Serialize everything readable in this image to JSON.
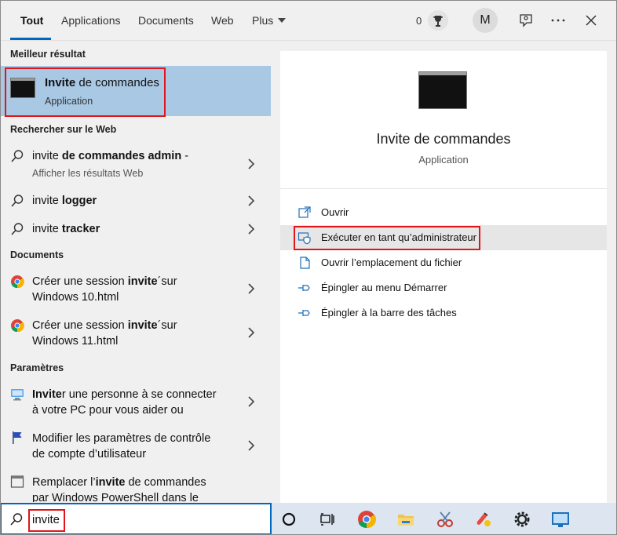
{
  "nav": {
    "tabs": [
      "Tout",
      "Applications",
      "Documents",
      "Web",
      "Plus"
    ],
    "points": "0",
    "avatar_letter": "M",
    "feedback_icon": "feedback-icon",
    "more_icon": "ellipsis-icon",
    "close_icon": "close-icon"
  },
  "sections": {
    "best": "Meilleur résultat",
    "web": "Rechercher sur le Web",
    "documents": "Documents",
    "settings": "Paramètres"
  },
  "best_result": {
    "title_bold": "Invite",
    "title_rest": " de commandes",
    "subtitle": "Application"
  },
  "web_results": [
    {
      "pre": "invite ",
      "bold": "de commandes admin",
      "post": " -",
      "sub": "Afficher les résultats Web"
    },
    {
      "pre": "invite ",
      "bold": "logger",
      "post": ""
    },
    {
      "pre": "invite ",
      "bold": "tracker",
      "post": ""
    }
  ],
  "documents": [
    {
      "l1_pre": "Créer une session ",
      "l1_bold": "invite",
      "l1_post": "´sur",
      "l2": "Windows 10.html"
    },
    {
      "l1_pre": "Créer une session ",
      "l1_bold": "invite",
      "l1_post": "´sur",
      "l2": "Windows 11.html"
    }
  ],
  "settings": [
    {
      "l1_bold": "Invite",
      "l1_post": "r une personne à se connecter",
      "l2": "à votre PC pour vous aider ou"
    },
    {
      "l1": "Modifier les paramètres de contrôle",
      "l2": "de compte d’utilisateur"
    },
    {
      "l1_pre": "Remplacer l’",
      "l1_bold": "invite",
      "l1_post": " de commandes",
      "l2": "par Windows PowerShell dans le"
    }
  ],
  "detail": {
    "title": "Invite de commandes",
    "subtitle": "Application",
    "actions": [
      {
        "label": "Ouvrir",
        "icon": "open-icon"
      },
      {
        "label": "Exécuter en tant qu’administrateur",
        "icon": "shield-icon"
      },
      {
        "label": "Ouvrir l’emplacement du fichier",
        "icon": "file-location-icon"
      },
      {
        "label": "Épingler au menu Démarrer",
        "icon": "pin-icon"
      },
      {
        "label": "Épingler à la barre des tâches",
        "icon": "pin-icon"
      }
    ]
  },
  "search": {
    "value": "invite"
  },
  "taskbar": [
    "cortana-icon",
    "task-view-icon",
    "chrome-icon",
    "file-explorer-icon",
    "snipping-tool-icon",
    "paint-icon",
    "settings-gear-icon",
    "monitor-app-icon"
  ],
  "colors": {
    "accent": "#0067c0",
    "selection": "#a8c8e4",
    "highlight_box": "#e0161b"
  }
}
